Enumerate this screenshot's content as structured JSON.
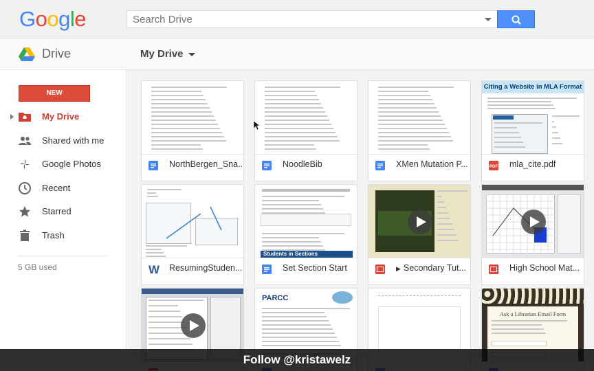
{
  "header": {
    "logo_letters": [
      {
        "ch": "G",
        "color": "#4285f4"
      },
      {
        "ch": "o",
        "color": "#ea4335"
      },
      {
        "ch": "o",
        "color": "#fbbc05"
      },
      {
        "ch": "g",
        "color": "#4285f4"
      },
      {
        "ch": "l",
        "color": "#34a853"
      },
      {
        "ch": "e",
        "color": "#ea4335"
      }
    ],
    "search_placeholder": "Search Drive"
  },
  "subheader": {
    "app_title": "Drive",
    "location": "My Drive"
  },
  "sidebar": {
    "new_label": "NEW",
    "items": [
      {
        "label": "My Drive",
        "icon": "my-drive-icon",
        "active": true
      },
      {
        "label": "Shared with me",
        "icon": "shared-people-icon",
        "active": false
      },
      {
        "label": "Google Photos",
        "icon": "photos-pinwheel-icon",
        "active": false
      },
      {
        "label": "Recent",
        "icon": "clock-icon",
        "active": false
      },
      {
        "label": "Starred",
        "icon": "star-icon",
        "active": false
      },
      {
        "label": "Trash",
        "icon": "trash-icon",
        "active": false
      }
    ],
    "storage_used": "5 GB used"
  },
  "files": [
    {
      "name": "NorthBergen_Sna...",
      "type": "doc",
      "icon_color": "#4285f4",
      "thumb": "doc"
    },
    {
      "name": "NoodleBib",
      "type": "doc",
      "icon_color": "#4285f4",
      "thumb": "doc"
    },
    {
      "name": "XMen Mutation P...",
      "type": "doc",
      "icon_color": "#4285f4",
      "thumb": "doc"
    },
    {
      "name": "mla_cite.pdf",
      "type": "pdf",
      "icon_color": "#db4437",
      "thumb": "mla"
    },
    {
      "name": "ResumingStuden...",
      "type": "word",
      "icon_color": "#2a5699",
      "thumb": "word"
    },
    {
      "name": "Set Section Start",
      "type": "doc",
      "icon_color": "#4285f4",
      "thumb": "doc2"
    },
    {
      "name": "Secondary Tut...",
      "type": "video",
      "icon_color": "#db4437",
      "thumb": "video1"
    },
    {
      "name": "High School Mat...",
      "type": "video",
      "icon_color": "#db4437",
      "thumb": "video2"
    },
    {
      "name": "",
      "type": "video",
      "icon_color": "#db4437",
      "thumb": "video3"
    },
    {
      "name": "",
      "type": "doc",
      "icon_color": "#4285f4",
      "thumb": "parcc"
    },
    {
      "name": "",
      "type": "doc",
      "icon_color": "#4285f4",
      "thumb": "blank"
    },
    {
      "name": "",
      "type": "doc",
      "icon_color": "#4285f4",
      "thumb": "form"
    }
  ],
  "thumb_text": {
    "mla_title": "Citing a Website in MLA Format",
    "parcc_logo": "PARCC",
    "form_title": "Ask a Librarian Email Form",
    "section_banner": "Students in Sections"
  },
  "banner": {
    "text": "Follow @kristawelz"
  }
}
